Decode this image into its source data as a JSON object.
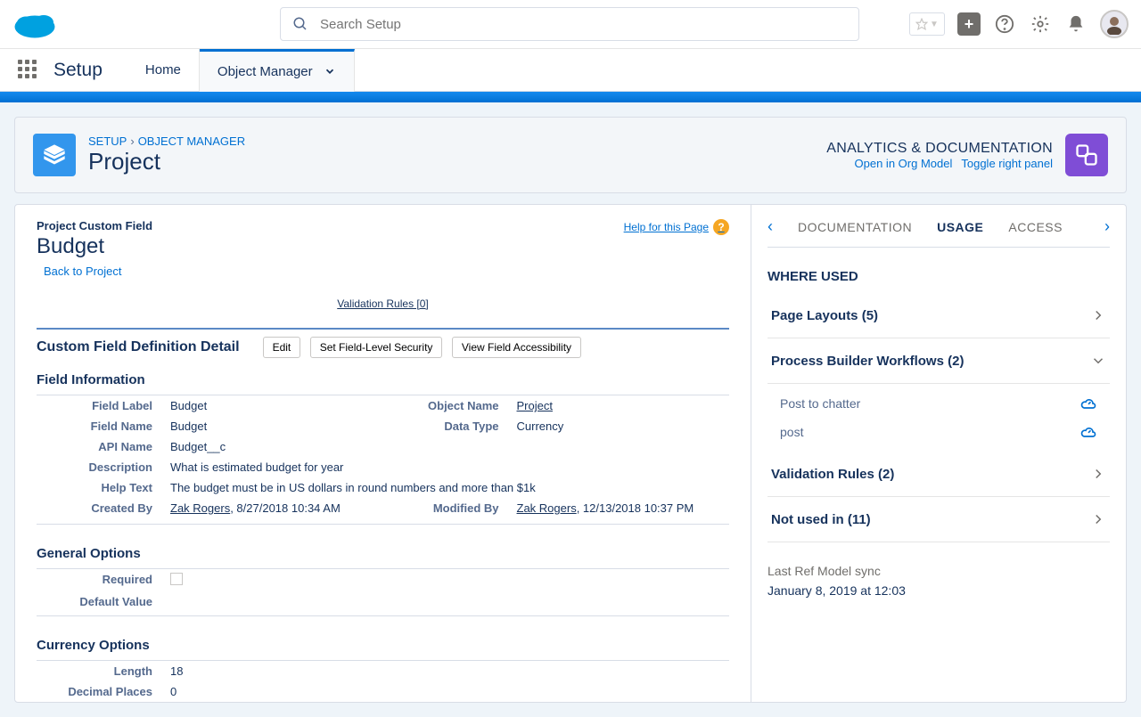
{
  "search": {
    "placeholder": "Search Setup"
  },
  "nav": {
    "title": "Setup",
    "home": "Home",
    "objManager": "Object Manager"
  },
  "breadcrumb": {
    "setup": "SETUP",
    "objManager": "OBJECT MANAGER"
  },
  "pageTitle": "Project",
  "analytics": {
    "title": "ANALYTICS & DOCUMENTATION",
    "open": "Open in Org Model",
    "toggle": "Toggle right panel"
  },
  "left": {
    "heading": "Project Custom Field",
    "title": "Budget",
    "back": "Back to Project",
    "help": "Help for this Page",
    "validation": "Validation Rules [0]",
    "section": "Custom Field Definition Detail",
    "btnEdit": "Edit",
    "btnFLS": "Set Field-Level Security",
    "btnView": "View Field Accessibility",
    "fieldInfo": "Field Information",
    "rows": {
      "fieldLabel": {
        "l": "Field Label",
        "v": "Budget"
      },
      "objectName": {
        "l": "Object Name",
        "v": "Project"
      },
      "fieldName": {
        "l": "Field Name",
        "v": "Budget"
      },
      "dataType": {
        "l": "Data Type",
        "v": "Currency"
      },
      "apiName": {
        "l": "API Name",
        "v": "Budget__c"
      },
      "description": {
        "l": "Description",
        "v": "What is estimated budget for year"
      },
      "helpText": {
        "l": "Help Text",
        "v": "The budget must be in US dollars in round numbers and more than $1k"
      },
      "createdBy": {
        "l": "Created By",
        "name": "Zak Rogers",
        "date": ", 8/27/2018 10:34 AM"
      },
      "modifiedBy": {
        "l": "Modified By",
        "name": "Zak Rogers",
        "date": ", 12/13/2018 10:37 PM"
      }
    },
    "general": "General Options",
    "required": "Required",
    "defaultValue": "Default Value",
    "currency": "Currency Options",
    "length": {
      "l": "Length",
      "v": "18"
    },
    "decimals": {
      "l": "Decimal Places",
      "v": "0"
    }
  },
  "right": {
    "tabs": {
      "doc": "DOCUMENTATION",
      "usage": "USAGE",
      "access": "ACCESS"
    },
    "whereUsed": "WHERE USED",
    "pageLayouts": "Page Layouts (5)",
    "processBuilder": "Process Builder Workflows (2)",
    "items": {
      "post1": "Post to chatter",
      "post2": "post"
    },
    "validation": "Validation Rules (2)",
    "notUsed": "Not used in (11)",
    "syncLabel": "Last Ref Model sync",
    "syncDate": "January 8, 2019 at 12:03"
  }
}
